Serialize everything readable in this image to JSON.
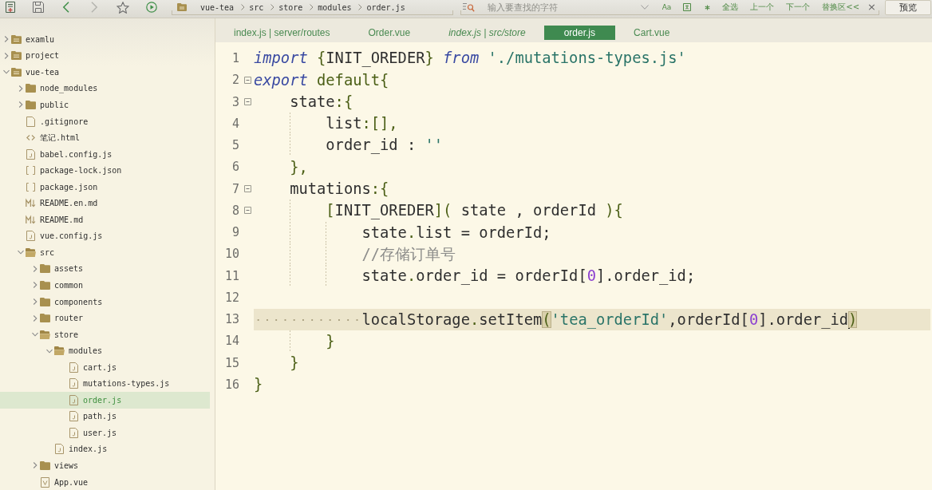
{
  "toolbar": {
    "buttons": [
      {
        "kind": "new-file",
        "disabled": false
      },
      {
        "kind": "save",
        "disabled": false
      },
      {
        "kind": "back",
        "disabled": false
      },
      {
        "kind": "forward",
        "disabled": true
      },
      {
        "kind": "bookmark",
        "disabled": false
      },
      {
        "kind": "run",
        "disabled": false
      }
    ],
    "breadcrumb": [
      "vue-tea",
      "src",
      "store",
      "modules",
      "order.js"
    ],
    "find_bar": {
      "placeholder": "输入要查找的字符",
      "case_toggle": "Aa",
      "actions": [
        "全选",
        "上一个",
        "下一个",
        "替换区<<"
      ],
      "close": "×"
    },
    "preview_button": "预览"
  },
  "tabs": [
    {
      "label": "index.js | server/routes",
      "selected": false,
      "preview": false
    },
    {
      "label": "Order.vue",
      "selected": false,
      "preview": false
    },
    {
      "label": "index.js | src/store",
      "selected": false,
      "preview": true
    },
    {
      "label": "order.js",
      "selected": true,
      "preview": false
    },
    {
      "label": "Cart.vue",
      "selected": false,
      "preview": false
    }
  ],
  "file_tree": [
    {
      "name": "examlu",
      "kind": "project",
      "expanded": false,
      "selected": false
    },
    {
      "name": "project",
      "kind": "project",
      "expanded": false,
      "selected": false
    },
    {
      "name": "vue-tea",
      "kind": "project",
      "expanded": true,
      "selected": false,
      "children": [
        {
          "name": "node_modules",
          "kind": "folder",
          "expanded": false,
          "selected": false
        },
        {
          "name": "public",
          "kind": "folder",
          "expanded": false,
          "selected": false
        },
        {
          "name": ".gitignore",
          "kind": "file",
          "selected": false
        },
        {
          "name": "笔记.html",
          "kind": "html",
          "selected": false
        },
        {
          "name": "babel.config.js",
          "kind": "js",
          "selected": false
        },
        {
          "name": "package-lock.json",
          "kind": "json",
          "selected": false
        },
        {
          "name": "package.json",
          "kind": "json",
          "selected": false
        },
        {
          "name": "README.en.md",
          "kind": "md",
          "selected": false
        },
        {
          "name": "README.md",
          "kind": "md",
          "selected": false
        },
        {
          "name": "vue.config.js",
          "kind": "js",
          "selected": false
        },
        {
          "name": "src",
          "kind": "folder",
          "expanded": true,
          "selected": false,
          "children": [
            {
              "name": "assets",
              "kind": "folder",
              "expanded": false,
              "selected": false
            },
            {
              "name": "common",
              "kind": "folder",
              "expanded": false,
              "selected": false
            },
            {
              "name": "components",
              "kind": "folder",
              "expanded": false,
              "selected": false
            },
            {
              "name": "router",
              "kind": "folder",
              "expanded": false,
              "selected": false
            },
            {
              "name": "store",
              "kind": "folder",
              "expanded": true,
              "selected": false,
              "children": [
                {
                  "name": "modules",
                  "kind": "folder",
                  "expanded": true,
                  "selected": false,
                  "children": [
                    {
                      "name": "cart.js",
                      "kind": "js",
                      "selected": false
                    },
                    {
                      "name": "mutations-types.js",
                      "kind": "js",
                      "selected": false
                    },
                    {
                      "name": "order.js",
                      "kind": "js",
                      "selected": true
                    },
                    {
                      "name": "path.js",
                      "kind": "js",
                      "selected": false
                    },
                    {
                      "name": "user.js",
                      "kind": "js",
                      "selected": false
                    }
                  ]
                },
                {
                  "name": "index.js",
                  "kind": "js",
                  "selected": false
                }
              ]
            },
            {
              "name": "views",
              "kind": "folder",
              "expanded": false,
              "selected": false
            },
            {
              "name": "App.vue",
              "kind": "vue",
              "selected": false
            }
          ]
        }
      ]
    }
  ],
  "editor": {
    "lines": [
      {
        "number": "1",
        "foldable": false,
        "current": false,
        "tokens": [
          {
            "kind": "keyword",
            "text": "import"
          },
          {
            "kind": "accent",
            "text": " {"
          },
          {
            "kind": "plain",
            "text": "INIT_OREDER"
          },
          {
            "kind": "accent",
            "text": "} "
          },
          {
            "kind": "keyword",
            "text": "from"
          },
          {
            "kind": "string",
            "text": " './mutations-types.js'"
          }
        ]
      },
      {
        "number": "2",
        "foldable": true,
        "current": false,
        "tokens": [
          {
            "kind": "keyword",
            "text": "export"
          },
          {
            "kind": "accent",
            "text": " default{"
          }
        ]
      },
      {
        "number": "3",
        "foldable": true,
        "current": false,
        "tokens": [
          {
            "kind": "plain",
            "text": "    state"
          },
          {
            "kind": "accent",
            "text": ":{"
          }
        ]
      },
      {
        "number": "4",
        "foldable": false,
        "current": false,
        "tokens": [
          {
            "kind": "plain",
            "text": "        list"
          },
          {
            "kind": "accent",
            "text": ":[],"
          }
        ]
      },
      {
        "number": "5",
        "foldable": false,
        "current": false,
        "tokens": [
          {
            "kind": "plain",
            "text": "        order_id : "
          },
          {
            "kind": "string",
            "text": "''"
          }
        ]
      },
      {
        "number": "6",
        "foldable": false,
        "current": false,
        "tokens": [
          {
            "kind": "accent",
            "text": "    },"
          }
        ]
      },
      {
        "number": "7",
        "foldable": true,
        "current": false,
        "tokens": [
          {
            "kind": "plain",
            "text": "    mutations"
          },
          {
            "kind": "accent",
            "text": ":{"
          }
        ]
      },
      {
        "number": "8",
        "foldable": true,
        "current": false,
        "tokens": [
          {
            "kind": "accent",
            "text": "        ["
          },
          {
            "kind": "plain",
            "text": "INIT_OREDER"
          },
          {
            "kind": "accent",
            "text": "]("
          },
          {
            "kind": "plain",
            "text": " state , orderId "
          },
          {
            "kind": "accent",
            "text": "){"
          }
        ]
      },
      {
        "number": "9",
        "foldable": false,
        "current": false,
        "tokens": [
          {
            "kind": "plain",
            "text": "            state"
          },
          {
            "kind": "accent",
            "text": "."
          },
          {
            "kind": "plain",
            "text": "list = orderId;"
          }
        ]
      },
      {
        "number": "10",
        "foldable": false,
        "current": false,
        "tokens": [
          {
            "kind": "comment",
            "text": "            //存储订单号"
          }
        ]
      },
      {
        "number": "11",
        "foldable": false,
        "current": false,
        "tokens": [
          {
            "kind": "plain",
            "text": "            state"
          },
          {
            "kind": "accent",
            "text": "."
          },
          {
            "kind": "plain",
            "text": "order_id = orderId["
          },
          {
            "kind": "number",
            "text": "0"
          },
          {
            "kind": "plain",
            "text": "].order_id;"
          }
        ]
      },
      {
        "number": "12",
        "foldable": false,
        "current": false
      },
      {
        "number": "13",
        "foldable": false,
        "current": true,
        "tokens": [
          {
            "kind": "plain",
            "text": "            localStorage"
          },
          {
            "kind": "accent",
            "text": "."
          },
          {
            "kind": "plain",
            "text": "setItem"
          },
          {
            "kind": "match",
            "text": "("
          },
          {
            "kind": "string",
            "text": "'tea_orderId'"
          },
          {
            "kind": "plain",
            "text": ",orderId["
          },
          {
            "kind": "number",
            "text": "0"
          },
          {
            "kind": "plain",
            "text": "].order_id"
          },
          {
            "kind": "caret"
          },
          {
            "kind": "match",
            "text": ")"
          }
        ]
      },
      {
        "number": "14",
        "foldable": false,
        "current": false,
        "tokens": [
          {
            "kind": "accent",
            "text": "        }"
          }
        ]
      },
      {
        "number": "15",
        "foldable": false,
        "current": false,
        "tokens": [
          {
            "kind": "accent",
            "text": "    }"
          }
        ]
      },
      {
        "number": "16",
        "foldable": false,
        "current": false,
        "tokens": [
          {
            "kind": "accent",
            "text": "}"
          }
        ]
      }
    ]
  }
}
